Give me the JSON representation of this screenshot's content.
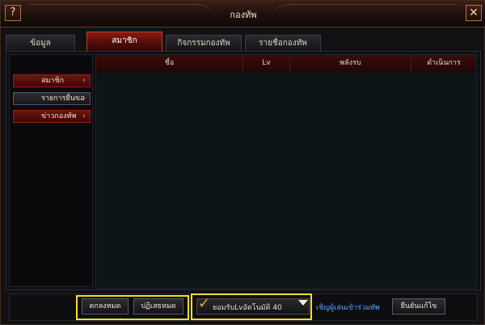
{
  "window": {
    "title": "กองทัพ",
    "help": "?",
    "close": "✕"
  },
  "tabs": [
    {
      "label": "ข้อมูล"
    },
    {
      "label": "สมาชิก"
    },
    {
      "label": "กิจกรรมกองทัพ"
    },
    {
      "label": "รายชื่อกองทัพ"
    }
  ],
  "sidebar": {
    "items": [
      {
        "label": "สมาชิก"
      },
      {
        "label": "รายการยื่นขอ"
      },
      {
        "label": "ข่าวกองทัพ"
      }
    ]
  },
  "table": {
    "columns": [
      {
        "label": "ชื่อ"
      },
      {
        "label": "Lv"
      },
      {
        "label": "พลังรบ"
      },
      {
        "label": "ดำเนินการ"
      }
    ],
    "rows": []
  },
  "bottom": {
    "accept_all": "ตกลงหมด",
    "reject_all": "ปฏิเสธหมด",
    "auto_accept": "ยอมรับLvอัตโนมัติ 40",
    "invite": "เชิญผู้เล่นเข้าร่วมทัพ",
    "confirm_edit": "ยืนยันแก้ไข"
  },
  "colors": {
    "highlight": "#f2e21e",
    "accent": "#8a1a12",
    "link": "#58a8ff"
  }
}
